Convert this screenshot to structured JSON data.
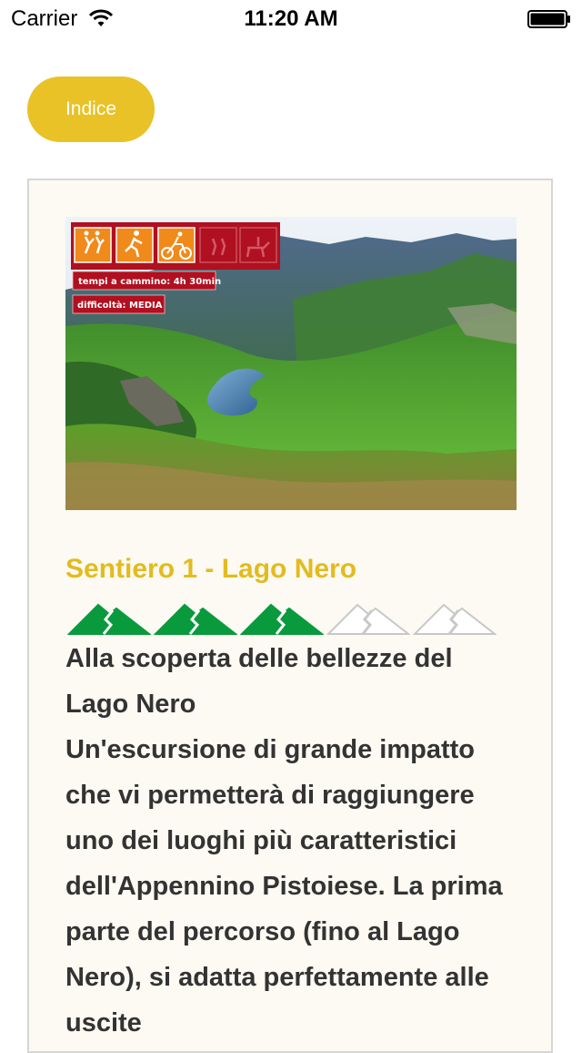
{
  "status_bar": {
    "carrier": "Carrier",
    "time": "11:20 AM"
  },
  "nav": {
    "index_label": "Indice"
  },
  "trail": {
    "image": {
      "activities": [
        "hiking-icon",
        "running-icon",
        "cycling-icon",
        "walking-icon",
        "horse-riding-icon"
      ],
      "active_activities": 3,
      "walking_time": "tempi a cammino: 4h 30min",
      "difficulty": "difficoltà: MEDIA"
    },
    "title": "Sentiero 1 - Lago Nero",
    "difficulty_rating": {
      "value": 3,
      "max": 5
    },
    "subtitle": "Alla scoperta delle bellezze del Lago Nero",
    "description": "Un'escursione di grande impatto che vi permetterà di raggiungere uno dei luoghi più caratteristici dell'Appennino Pistoiese. La prima parte del percorso (fino al Lago Nero), si adatta perfettamente alle uscite"
  },
  "colors": {
    "accent": "#e8c226",
    "title": "#e3bb1f",
    "rating_on": "#0a9a3e",
    "rating_off": "#ffffff",
    "badge": "#b01020"
  }
}
